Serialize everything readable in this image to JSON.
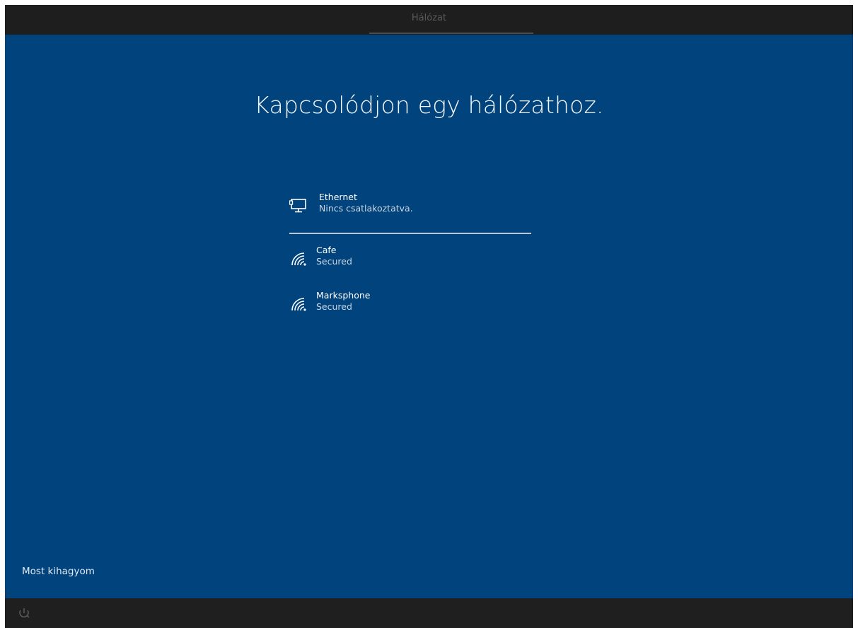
{
  "topbar": {
    "title": "Hálózat"
  },
  "main": {
    "headline": "Kapcsolódjon egy hálózathoz.",
    "networks": [
      {
        "name": "Ethernet",
        "status": "Nincs csatlakoztatva.",
        "icon": "ethernet-monitor-icon"
      },
      {
        "name": "Cafe",
        "status": "Secured",
        "icon": "wifi-icon"
      },
      {
        "name": "Marksphone",
        "status": "Secured",
        "icon": "wifi-icon"
      }
    ],
    "skip_label": "Most kihagyom"
  },
  "bottombar": {
    "icon": "ease-of-access-icon"
  },
  "colors": {
    "background": "#01437c",
    "bars": "#1f1f1f",
    "text": "#ffffff"
  }
}
